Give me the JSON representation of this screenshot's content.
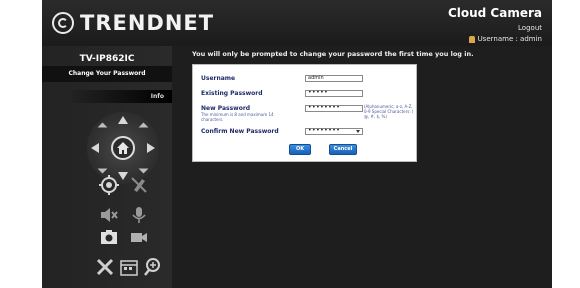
{
  "header": {
    "logo_text": "TRENDNET",
    "title": "Cloud Camera",
    "logout": "Logout",
    "username_label": "Username : admin"
  },
  "sidebar": {
    "model": "TV-IP862IC",
    "change_password": "Change Your Password",
    "info": "Info",
    "ptz_icons": [
      "up-arrow-icon",
      "down-arrow-icon",
      "left-arrow-icon",
      "right-arrow-icon",
      "home-icon"
    ],
    "tool_icons": [
      "target-icon",
      "pencil-off-icon",
      "speaker-mute-icon",
      "microphone-icon",
      "snapshot-icon",
      "video-camera-icon",
      "settings-tools-icon",
      "calendar-icon",
      "zoom-icon"
    ]
  },
  "main": {
    "notice": "You will only be prompted to change your password the first time you log in.",
    "username_label": "Username",
    "username_value": "admin",
    "existing_label": "Existing Password",
    "existing_value": "•••••",
    "new_label": "New Password",
    "new_note": "The minimum is 8 and maximum 14 characters.",
    "new_value": "••••••••",
    "new_hint": "(Alphanumeric; a-z, A-Z, 0-9 Special Characters: ( @, #, $, %)",
    "confirm_label": "Confirm New Password",
    "confirm_value": "••••••••",
    "ok_button": "OK",
    "cancel_button": "Cancel"
  },
  "colors": {
    "background": "#1e1e1e",
    "button_blue": "#2a76cf",
    "label_blue": "#1f2a6b",
    "user_icon": "#d9a84a"
  }
}
